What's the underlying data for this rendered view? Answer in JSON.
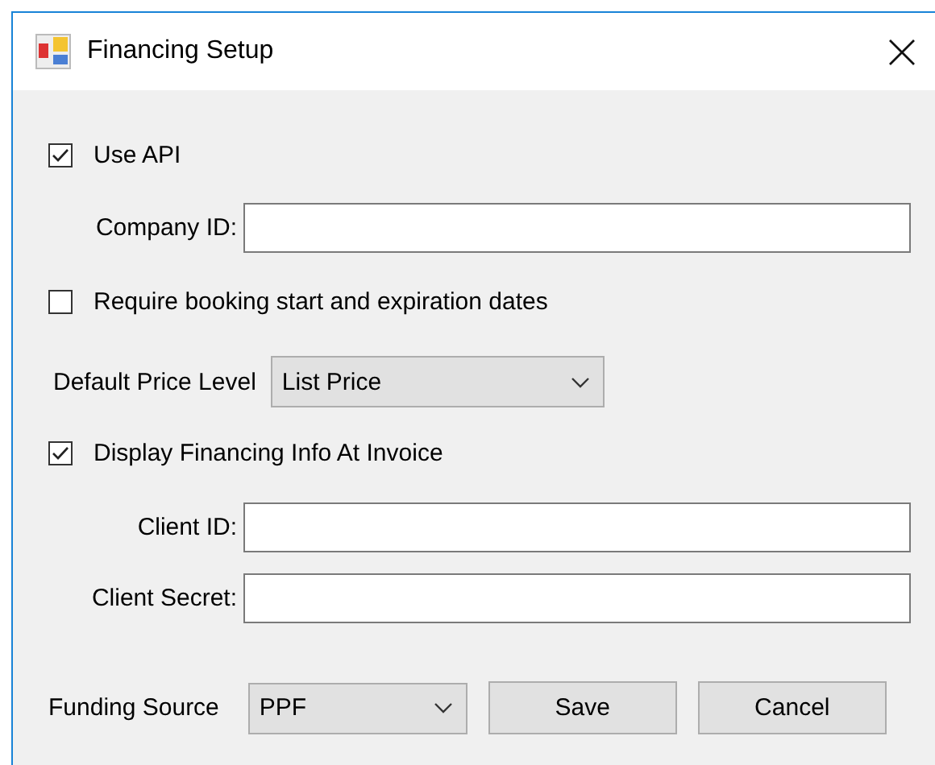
{
  "window": {
    "title": "Financing Setup"
  },
  "use_api": {
    "label": "Use API",
    "checked": true
  },
  "company_id": {
    "label": "Company ID:"
  },
  "require_dates": {
    "label": "Require booking start and expiration dates",
    "checked": false
  },
  "default_price_level": {
    "label": "Default Price Level",
    "value": "List Price"
  },
  "display_financing": {
    "label": "Display Financing Info At Invoice",
    "checked": true
  },
  "client_id": {
    "label": "Client ID:"
  },
  "client_secret": {
    "label": "Client Secret:"
  },
  "funding_source": {
    "label": "Funding Source",
    "value": "PPF"
  },
  "buttons": [
    {
      "label": "Save"
    },
    {
      "label": "Cancel"
    }
  ]
}
